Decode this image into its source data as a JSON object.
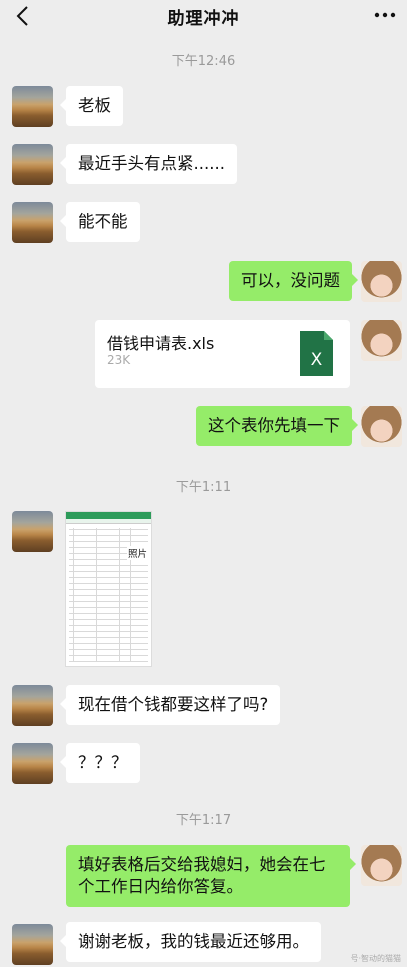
{
  "header": {
    "title": "助理冲冲"
  },
  "timestamps": [
    "下午12:46",
    "下午1:11",
    "下午1:17"
  ],
  "messages": {
    "m1": "老板",
    "m2": "最近手头有点紧......",
    "m3": "能不能",
    "m4": "可以，没问题",
    "m6": "这个表你先填一下",
    "m8": "现在借个钱都要这样了吗?",
    "m9": "？？？",
    "m10": "填好表格后交给我媳妇，她会在七个工作日内给你答复。",
    "m11": "谢谢老板，我的钱最近还够用。"
  },
  "file": {
    "name": "借钱申请表.xls",
    "size": "23K",
    "icon": "excel-file-icon",
    "icon_letter": "X",
    "icon_color": "#217346"
  },
  "sheet_image": {
    "photo_label": "照片"
  },
  "colors": {
    "background": "#ededed",
    "outgoing_bubble": "#95ec69",
    "incoming_bubble": "#ffffff"
  },
  "watermark": "号·智动的猫猫"
}
